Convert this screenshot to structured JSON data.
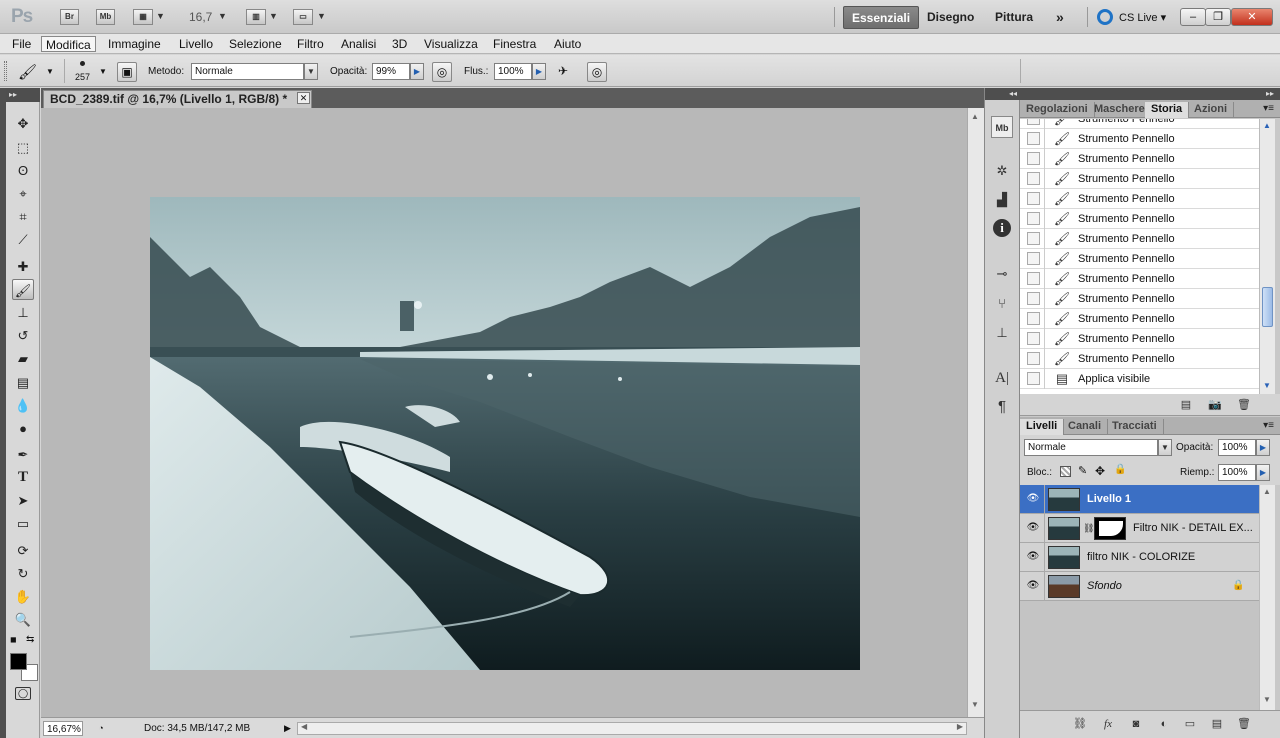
{
  "app": {
    "logo": "Ps",
    "bridge_label": "Br",
    "minibridge_label": "Mb",
    "zoom": "16,7"
  },
  "workspaces": [
    "Essenziali",
    "Disegno",
    "Pittura"
  ],
  "workspace_more": "»",
  "cslive": "CS Live",
  "window_buttons": {
    "minimize": "–",
    "restore": "❐",
    "close": "✕"
  },
  "menu": [
    "File",
    "Modifica",
    "Immagine",
    "Livello",
    "Selezione",
    "Filtro",
    "Analisi",
    "3D",
    "Visualizza",
    "Finestra",
    "Aiuto"
  ],
  "options": {
    "brush_size": "257",
    "metodo_label": "Metodo:",
    "metodo_value": "Normale",
    "opacita_label": "Opacità:",
    "opacita_value": "99%",
    "flusso_label": "Flus.:",
    "flusso_value": "100%"
  },
  "document": {
    "tab_title": "BCD_2389.tif @ 16,7% (Livello 1, RGB/8) *",
    "zoom_status": "16,67%",
    "doc_status": "Doc: 34,5 MB/147,2 MB"
  },
  "history_panel": {
    "tabs": [
      "Regolazioni",
      "Maschere",
      "Storia",
      "Azioni"
    ],
    "active_tab": "Storia",
    "items": [
      "Strumento Pennello",
      "Strumento Pennello",
      "Strumento Pennello",
      "Strumento Pennello",
      "Strumento Pennello",
      "Strumento Pennello",
      "Strumento Pennello",
      "Strumento Pennello",
      "Strumento Pennello",
      "Strumento Pennello",
      "Strumento Pennello",
      "Strumento Pennello",
      "Strumento Pennello",
      "Applica visibile"
    ]
  },
  "layers_panel": {
    "tabs": [
      "Livelli",
      "Canali",
      "Tracciati"
    ],
    "active_tab": "Livelli",
    "blend_mode": "Normale",
    "opacity_label": "Opacità:",
    "opacity_value": "100%",
    "lock_label": "Bloc.:",
    "fill_label": "Riemp.:",
    "fill_value": "100%",
    "layers": [
      {
        "name": "Livello 1",
        "selected": true
      },
      {
        "name": "Filtro NIK - DETAIL EX...",
        "selected": false
      },
      {
        "name": "filtro NIK - COLORIZE",
        "selected": false
      },
      {
        "name": "Sfondo",
        "selected": false
      }
    ]
  },
  "colors": {
    "accent_selected_layer": "#3b6fc4",
    "close_button": "#c2301d"
  }
}
